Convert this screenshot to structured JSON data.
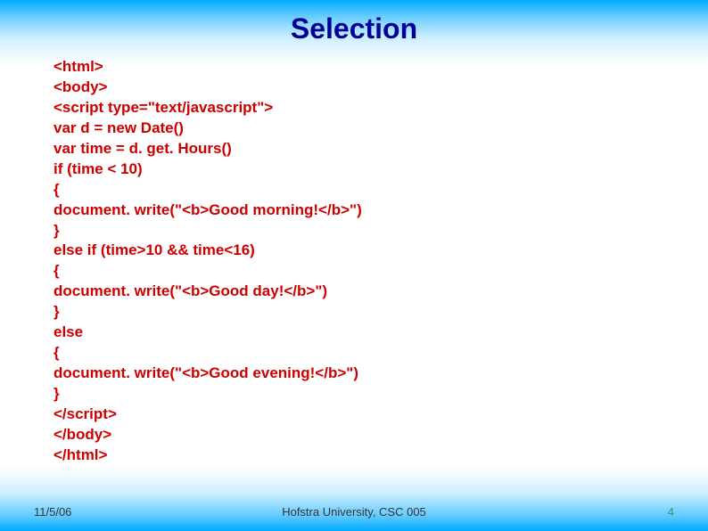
{
  "slide": {
    "title": "Selection",
    "code_lines": [
      "<html>",
      "<body>",
      "<script type=\"text/javascript\">",
      "var d = new Date()",
      "var time = d. get. Hours()",
      "if (time < 10)",
      "{",
      "document. write(\"<b>Good morning!</b>\")",
      "}",
      "else if (time>10 && time<16)",
      "{",
      "document. write(\"<b>Good day!</b>\")",
      "}",
      "else",
      "{",
      "document. write(\"<b>Good evening!</b>\")",
      "}",
      "</script>",
      "</body>",
      "</html>"
    ]
  },
  "footer": {
    "date": "11/5/06",
    "center": "Hofstra University, CSC 005",
    "page": "4"
  }
}
